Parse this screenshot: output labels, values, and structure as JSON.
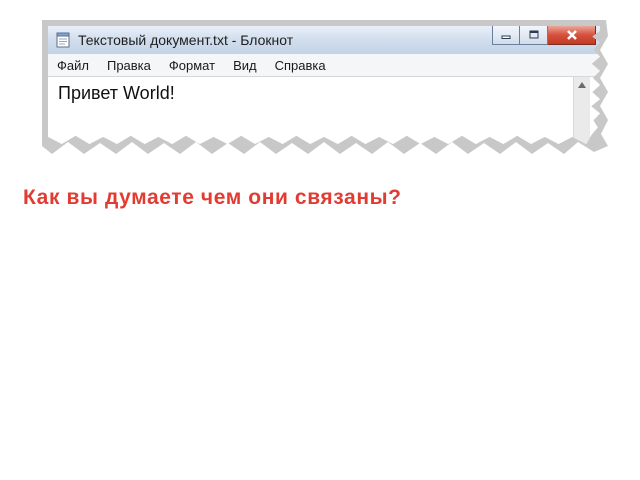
{
  "window": {
    "title": "Текстовый документ.txt - Блокнот",
    "buttons": {
      "minimize_icon": "minimize-icon",
      "maximize_icon": "maximize-icon",
      "close_icon": "close-icon"
    }
  },
  "menu": {
    "items": [
      {
        "label": "Файл"
      },
      {
        "label": "Правка"
      },
      {
        "label": "Формат"
      },
      {
        "label": "Вид"
      },
      {
        "label": "Справка"
      }
    ]
  },
  "editor": {
    "content": "Привет World!"
  },
  "question": {
    "text": "Как вы думаете чем они связаны?"
  },
  "colors": {
    "question": "#e23c32",
    "close_button": "#d6503c",
    "titlebar": "#cfdcec"
  }
}
